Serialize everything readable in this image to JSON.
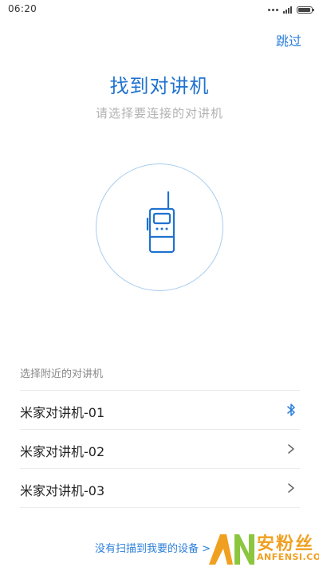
{
  "status_bar": {
    "time": "06:20",
    "battery_level": 0.95
  },
  "header": {
    "skip_label": "跳过"
  },
  "main": {
    "title": "找到对讲机",
    "subtitle": "请选择要连接的对讲机"
  },
  "devices": {
    "section_label": "选择附近的对讲机",
    "items": [
      {
        "label": "米家对讲机-01",
        "icon": "bluetooth-icon"
      },
      {
        "label": "米家对讲机-02",
        "icon": "chevron-right-icon"
      },
      {
        "label": "米家对讲机-03",
        "icon": "chevron-right-icon"
      }
    ]
  },
  "footer": {
    "link_label": "没有扫描到我要的设备 >"
  },
  "watermark": {
    "text_top": "安粉丝",
    "text_bottom": "ANFENSI.COM"
  },
  "colors": {
    "accent": "#1f72cf",
    "link": "#2b7fd9",
    "circle_border": "#a9cdef",
    "watermark": "#f0a020"
  }
}
